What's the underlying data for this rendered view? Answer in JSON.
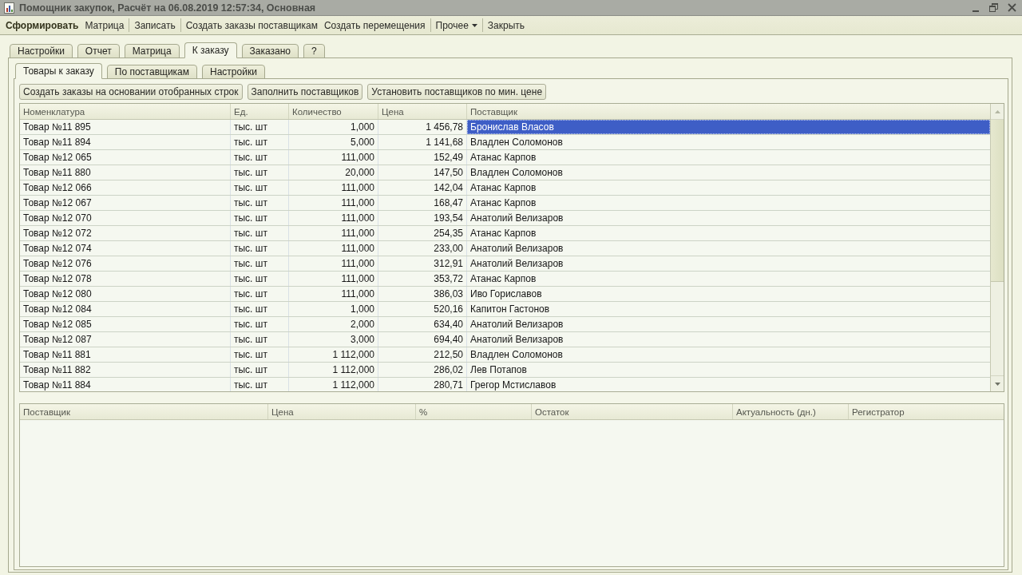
{
  "window": {
    "title": "Помощник закупок, Расчёт на 06.08.2019 12:57:34, Основная"
  },
  "toolbar": {
    "groups": [
      {
        "items": [
          {
            "label": "Сформировать",
            "kind": "default"
          },
          {
            "label": "Матрица",
            "kind": "command"
          }
        ]
      },
      {
        "items": [
          {
            "label": "Записать",
            "kind": "command"
          }
        ]
      },
      {
        "items": [
          {
            "label": "Создать заказы поставщикам",
            "kind": "command"
          },
          {
            "label": "Создать перемещения",
            "kind": "command"
          }
        ]
      },
      {
        "items": [
          {
            "label": "Прочее",
            "kind": "menu"
          }
        ]
      },
      {
        "items": [
          {
            "label": "Закрыть",
            "kind": "command"
          }
        ]
      }
    ]
  },
  "tabs": [
    {
      "label": "Настройки",
      "selected": false
    },
    {
      "label": "Отчет",
      "selected": false
    },
    {
      "label": "Матрица",
      "selected": false
    },
    {
      "label": "К заказу",
      "selected": true
    },
    {
      "label": "Заказано",
      "selected": false
    },
    {
      "label": "?",
      "selected": false
    }
  ],
  "subtabs": [
    {
      "label": "Товары к заказу",
      "selected": true
    },
    {
      "label": "По поставщикам",
      "selected": false
    },
    {
      "label": "Настройки",
      "selected": false
    }
  ],
  "actions": [
    "Создать заказы на основании отобранных строк",
    "Заполнить поставщиков",
    "Установить поставщиков по мин. цене"
  ],
  "table": {
    "columns": [
      {
        "label": "Номенклатура",
        "kind": "text",
        "current": false
      },
      {
        "label": "Ед.",
        "kind": "text",
        "current": false
      },
      {
        "label": "Количество",
        "kind": "number",
        "current": false
      },
      {
        "label": "Цена",
        "kind": "number",
        "current": false
      },
      {
        "label": "Поставщик",
        "kind": "text",
        "current": true
      }
    ],
    "rows": [
      {
        "cells": [
          "Товар №11 895",
          "тыс. шт",
          "1,000",
          "1 456,78",
          "Бронислав Власов"
        ],
        "selected": true
      },
      {
        "cells": [
          "Товар №11 894",
          "тыс. шт",
          "5,000",
          "1 141,68",
          "Владлен Соломонов"
        ],
        "selected": false
      },
      {
        "cells": [
          "Товар №12 065",
          "тыс. шт",
          "111,000",
          "152,49",
          "Атанас Карпов"
        ],
        "selected": false
      },
      {
        "cells": [
          "Товар №11 880",
          "тыс. шт",
          "20,000",
          "147,50",
          "Владлен Соломонов"
        ],
        "selected": false
      },
      {
        "cells": [
          "Товар №12 066",
          "тыс. шт",
          "111,000",
          "142,04",
          "Атанас Карпов"
        ],
        "selected": false
      },
      {
        "cells": [
          "Товар №12 067",
          "тыс. шт",
          "111,000",
          "168,47",
          "Атанас Карпов"
        ],
        "selected": false
      },
      {
        "cells": [
          "Товар №12 070",
          "тыс. шт",
          "111,000",
          "193,54",
          "Анатолий Велизаров"
        ],
        "selected": false
      },
      {
        "cells": [
          "Товар №12 072",
          "тыс. шт",
          "111,000",
          "254,35",
          "Атанас Карпов"
        ],
        "selected": false
      },
      {
        "cells": [
          "Товар №12 074",
          "тыс. шт",
          "111,000",
          "233,00",
          "Анатолий Велизаров"
        ],
        "selected": false
      },
      {
        "cells": [
          "Товар №12 076",
          "тыс. шт",
          "111,000",
          "312,91",
          "Анатолий Велизаров"
        ],
        "selected": false
      },
      {
        "cells": [
          "Товар №12 078",
          "тыс. шт",
          "111,000",
          "353,72",
          "Атанас Карпов"
        ],
        "selected": false
      },
      {
        "cells": [
          "Товар №12 080",
          "тыс. шт",
          "111,000",
          "386,03",
          "Иво Гориславов"
        ],
        "selected": false
      },
      {
        "cells": [
          "Товар №12 084",
          "тыс. шт",
          "1,000",
          "520,16",
          "Капитон Гастонов"
        ],
        "selected": false
      },
      {
        "cells": [
          "Товар №12 085",
          "тыс. шт",
          "2,000",
          "634,40",
          "Анатолий Велизаров"
        ],
        "selected": false
      },
      {
        "cells": [
          "Товар №12 087",
          "тыс. шт",
          "3,000",
          "694,40",
          "Анатолий Велизаров"
        ],
        "selected": false
      },
      {
        "cells": [
          "Товар №11 881",
          "тыс. шт",
          "1 112,000",
          "212,50",
          "Владлен Соломонов"
        ],
        "selected": false
      },
      {
        "cells": [
          "Товар №11 882",
          "тыс. шт",
          "1 112,000",
          "286,02",
          "Лев Потапов"
        ],
        "selected": false
      },
      {
        "cells": [
          "Товар №11 884",
          "тыс. шт",
          "1 112,000",
          "280,71",
          "Грегор Мстиславов"
        ],
        "selected": false
      }
    ]
  },
  "details_table": {
    "columns": [
      "Поставщик",
      "Цена",
      "%",
      "Остаток",
      "Актуальность (дн.)",
      "Регистратор"
    ]
  }
}
